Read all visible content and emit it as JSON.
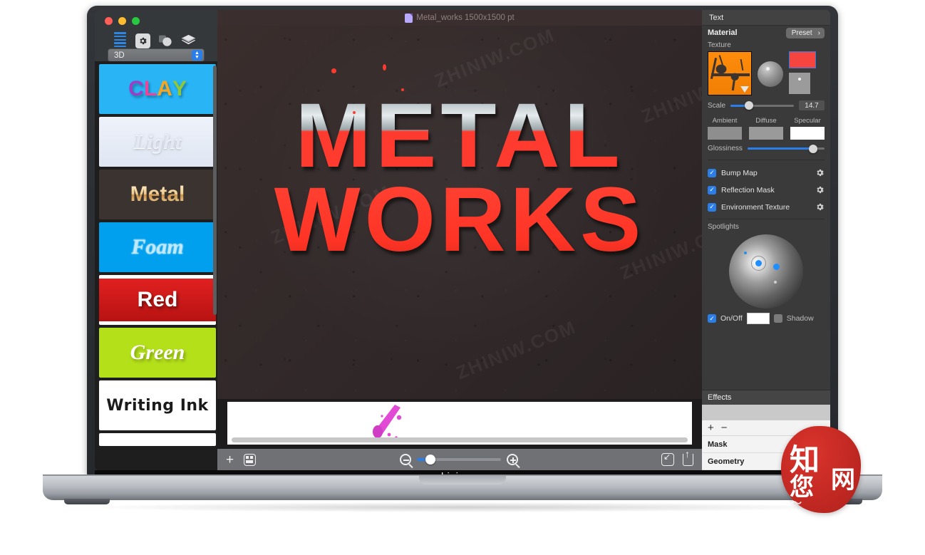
{
  "brand": {
    "watermark_bar": "zhiniw.com",
    "canvas_watermark": "ZHINIW.COM",
    "seal": {
      "chars": [
        "知",
        "网",
        "您"
      ],
      "flourish": "〜"
    }
  },
  "window": {
    "traffic_lights": [
      "close",
      "minimize",
      "zoom"
    ],
    "document_title": "Metal_works 1500x1500 pt"
  },
  "left_panel": {
    "toolbar_icons": [
      "list-icon",
      "gear-icon",
      "shapes-icon",
      "layers-icon"
    ],
    "category_select": {
      "value": "3D",
      "options": [
        "3D"
      ]
    },
    "presets": [
      {
        "name": "CLAY",
        "label": "CLAY"
      },
      {
        "name": "Light",
        "label": "Light"
      },
      {
        "name": "Metal",
        "label": "Metal"
      },
      {
        "name": "Foam",
        "label": "Foam"
      },
      {
        "name": "Red",
        "label": "Red"
      },
      {
        "name": "Green",
        "label": "Green"
      },
      {
        "name": "Writing Ink",
        "label": "Writing Ink"
      }
    ]
  },
  "canvas": {
    "art_line1": "METAL",
    "art_line2": "WORKS"
  },
  "bottom_bar": {
    "add_label": "+",
    "grid_icon": "grid-icon",
    "zoom_out_icon": "zoom-out-icon",
    "zoom_in_icon": "zoom-in-icon",
    "fit_icon": "fit-to-screen-icon",
    "share_icon": "share-icon",
    "zoom_value": "14"
  },
  "right_panel": {
    "header": "Text",
    "material": {
      "title": "Material",
      "preset_button": "Preset",
      "preset_chevron": "›",
      "texture_label": "Texture",
      "texture_swatch_color": "#ff8c0a",
      "color_swatch": "#f6453f",
      "scale_label": "Scale",
      "scale_value": "14.7",
      "channels": [
        {
          "name": "Ambient",
          "color": "#8e8e8e"
        },
        {
          "name": "Diffuse",
          "color": "#9a9a9a"
        },
        {
          "name": "Specular",
          "color": "#ffffff"
        }
      ],
      "glossiness_label": "Glossiness",
      "toggles": [
        {
          "label": "Bump Map",
          "checked": true
        },
        {
          "label": "Reflection Mask",
          "checked": true
        },
        {
          "label": "Environment Texture",
          "checked": true
        }
      ]
    },
    "spotlights": {
      "title": "Spotlights",
      "onoff_label": "On/Off",
      "onoff_checked": true,
      "light_color": "#ffffff",
      "shadow_label": "Shadow",
      "shadow_checked": false
    },
    "effects": {
      "title": "Effects",
      "add_label": "+",
      "remove_label": "−",
      "items": [
        "Mask",
        "Geometry"
      ]
    }
  },
  "colors": {
    "accent_blue": "#2b7ee8",
    "art_red": "#ff3b2f",
    "canvas_bg": "#332a29",
    "panel_bg": "#3a3a3a"
  }
}
